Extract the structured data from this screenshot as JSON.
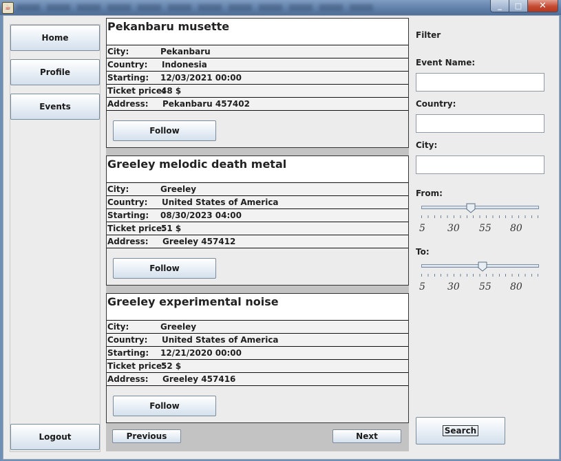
{
  "window": {
    "app_icon": "java-cup-icon",
    "controls": {
      "minimize": "_",
      "maximize": "□",
      "close": "✕"
    }
  },
  "nav": {
    "home": "Home",
    "profile": "Profile",
    "events": "Events",
    "logout": "Logout"
  },
  "row_labels": {
    "city": "City:",
    "country": "Country:",
    "starting": "Starting:",
    "ticket_price": "Ticket price:",
    "address": "Address:"
  },
  "events": [
    {
      "title": "Pekanbaru musette",
      "city": "Pekanbaru",
      "country": "Indonesia",
      "starting": "12/03/2021 00:00",
      "ticket_price": "48 $",
      "address": "Pekanbaru 457402",
      "follow_label": "Follow"
    },
    {
      "title": "Greeley melodic death metal",
      "city": "Greeley",
      "country": "United States of America",
      "starting": "08/30/2023 04:00",
      "ticket_price": "51 $",
      "address": "Greeley 457412",
      "follow_label": "Follow"
    },
    {
      "title": "Greeley experimental noise",
      "city": "Greeley",
      "country": "United States of America",
      "starting": "12/21/2020 00:00",
      "ticket_price": "52 $",
      "address": "Greeley 457416",
      "follow_label": "Follow"
    }
  ],
  "pager": {
    "previous": "Previous",
    "next": "Next"
  },
  "filter": {
    "title": "Filter",
    "event_name_label": "Event Name:",
    "event_name_value": "",
    "country_label": "Country:",
    "country_value": "",
    "city_label": "City:",
    "city_value": "",
    "from_label": "From:",
    "to_label": "To:",
    "slider_ticks": [
      "5",
      "30",
      "55",
      "80"
    ],
    "slider_min": 5,
    "slider_max": 100,
    "from_value": 45,
    "to_value": 55,
    "search_label": "Search"
  }
}
